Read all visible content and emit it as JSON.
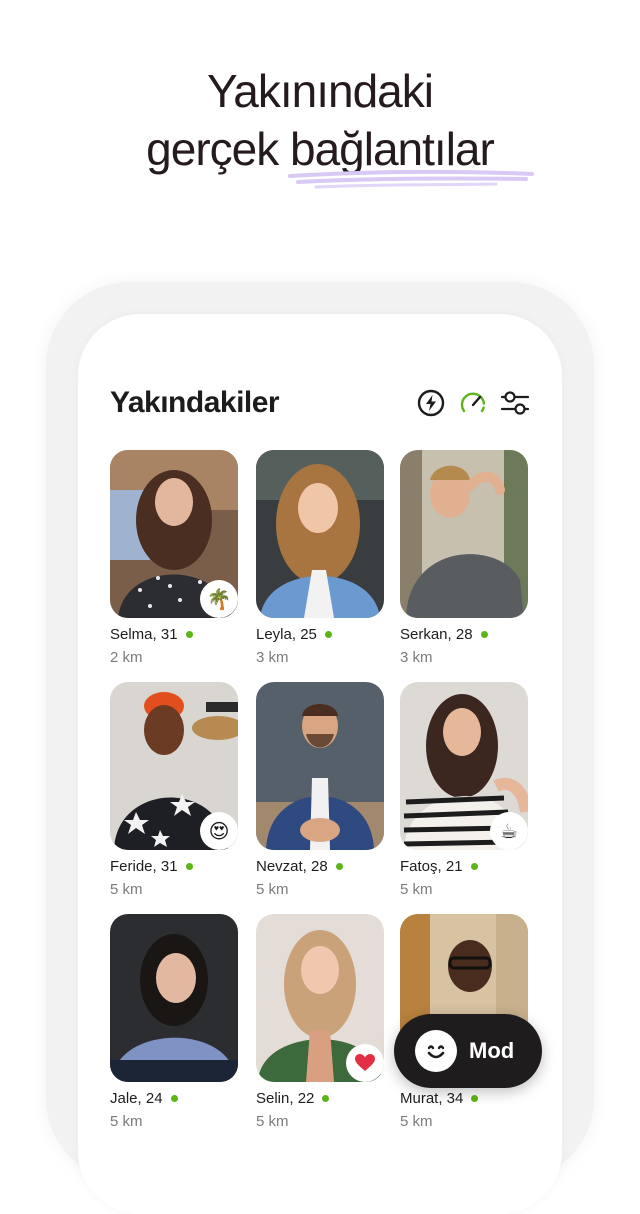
{
  "headline": {
    "line1": "Yakınındaki",
    "line2": "gerçek bağlantılar"
  },
  "screen": {
    "title": "Yakındakiler",
    "icons": [
      "boost-icon",
      "speedometer-icon",
      "filter-sliders-icon"
    ]
  },
  "profiles": [
    {
      "name": "Selma, 31",
      "distance": "2 km",
      "online": true,
      "badge": "🌴"
    },
    {
      "name": "Leyla, 25",
      "distance": "3 km",
      "online": true,
      "badge": ""
    },
    {
      "name": "Serkan, 28",
      "distance": "3 km",
      "online": true,
      "badge": ""
    },
    {
      "name": "Feride, 31",
      "distance": "5 km",
      "online": true,
      "badge": "😍"
    },
    {
      "name": "Nevzat, 28",
      "distance": "5 km",
      "online": true,
      "badge": ""
    },
    {
      "name": "Fatoş, 21",
      "distance": "5 km",
      "online": true,
      "badge": "☕"
    },
    {
      "name": "Jale, 24",
      "distance": "5 km",
      "online": true,
      "badge": ""
    },
    {
      "name": "Selin, 22",
      "distance": "5 km",
      "online": true,
      "badge": "❤"
    },
    {
      "name": "Murat, 34",
      "distance": "5 km",
      "online": true,
      "badge": ""
    }
  ],
  "mod_button": {
    "label": "Mod"
  },
  "colors": {
    "accent_green": "#5cb516",
    "underline_lavender": "#d9c9f5",
    "dark": "#1f1c1e"
  }
}
